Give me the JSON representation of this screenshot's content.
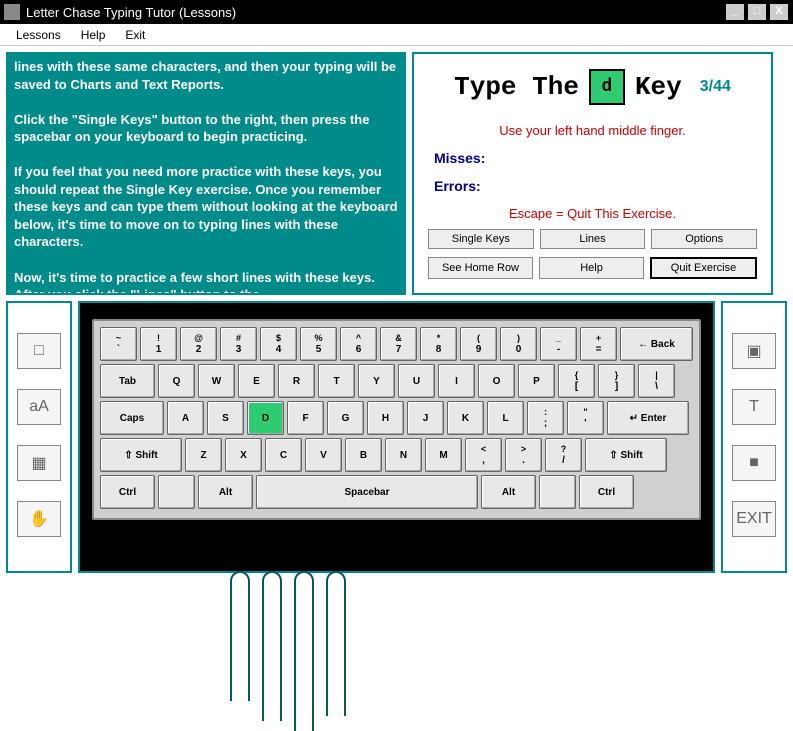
{
  "window": {
    "title": "Letter Chase Typing Tutor (Lessons)",
    "minimize": "_",
    "maximize": "□",
    "close": "X"
  },
  "menu": {
    "lessons": "Lessons",
    "help": "Help",
    "exit": "Exit"
  },
  "instructions": "lines with these same characters, and then your typing will be saved to Charts and Text Reports.\n\nClick the \"Single Keys\" button to the right, then press the spacebar on your keyboard to begin practicing.\n\nIf you feel that you need more practice with these keys, you should repeat the Single Key exercise. Once you remember these keys and can type them without looking at the keyboard below, it's time to move on to typing lines with these characters.\n\nNow, it's time to practice a few short lines with these keys. After you click the \"Lines\" button to the",
  "exercise": {
    "type_the": "Type The",
    "target_key": "d",
    "key_word": "Key",
    "progress": "3/44",
    "hint": "Use your left hand middle finger.",
    "misses_label": "Misses:",
    "errors_label": "Errors:",
    "escape_hint": "Escape = Quit This Exercise.",
    "buttons": {
      "single_keys": "Single Keys",
      "lines": "Lines",
      "options": "Options",
      "see_home_row": "See Home Row",
      "help": "Help",
      "quit": "Quit Exercise"
    }
  },
  "keyboard": {
    "row1": [
      [
        "~",
        "`"
      ],
      [
        "!",
        "1"
      ],
      [
        "@",
        "2"
      ],
      [
        "#",
        "3"
      ],
      [
        "$",
        "4"
      ],
      [
        "%",
        "5"
      ],
      [
        "^",
        "6"
      ],
      [
        "&",
        "7"
      ],
      [
        "*",
        "8"
      ],
      [
        "(",
        "9"
      ],
      [
        ")",
        "0"
      ],
      [
        "_",
        "-"
      ],
      [
        "+",
        "="
      ]
    ],
    "back": "← Back",
    "tab": "Tab",
    "row2": [
      "Q",
      "W",
      "E",
      "R",
      "T",
      "Y",
      "U",
      "I",
      "O",
      "P"
    ],
    "row2b": [
      [
        "{",
        "["
      ],
      [
        "}",
        "]"
      ],
      [
        "|",
        "\\"
      ]
    ],
    "caps": "Caps",
    "row3": [
      "A",
      "S",
      "D",
      "F",
      "G",
      "H",
      "J",
      "K",
      "L"
    ],
    "row3b": [
      [
        ":",
        ";"
      ],
      [
        "\"",
        "'"
      ]
    ],
    "enter": "↵ Enter",
    "shift": "⇧ Shift",
    "row4": [
      "Z",
      "X",
      "C",
      "V",
      "B",
      "N",
      "M"
    ],
    "row4b": [
      [
        "<",
        ","
      ],
      [
        ">",
        "."
      ],
      [
        "?",
        "/"
      ]
    ],
    "ctrl": "Ctrl",
    "alt": "Alt",
    "space": "Spacebar",
    "highlight": "d"
  },
  "left_icons": [
    "□",
    "aA",
    "▦",
    "✋"
  ],
  "right_icons": [
    "▣",
    "T",
    "■",
    "EXIT"
  ]
}
